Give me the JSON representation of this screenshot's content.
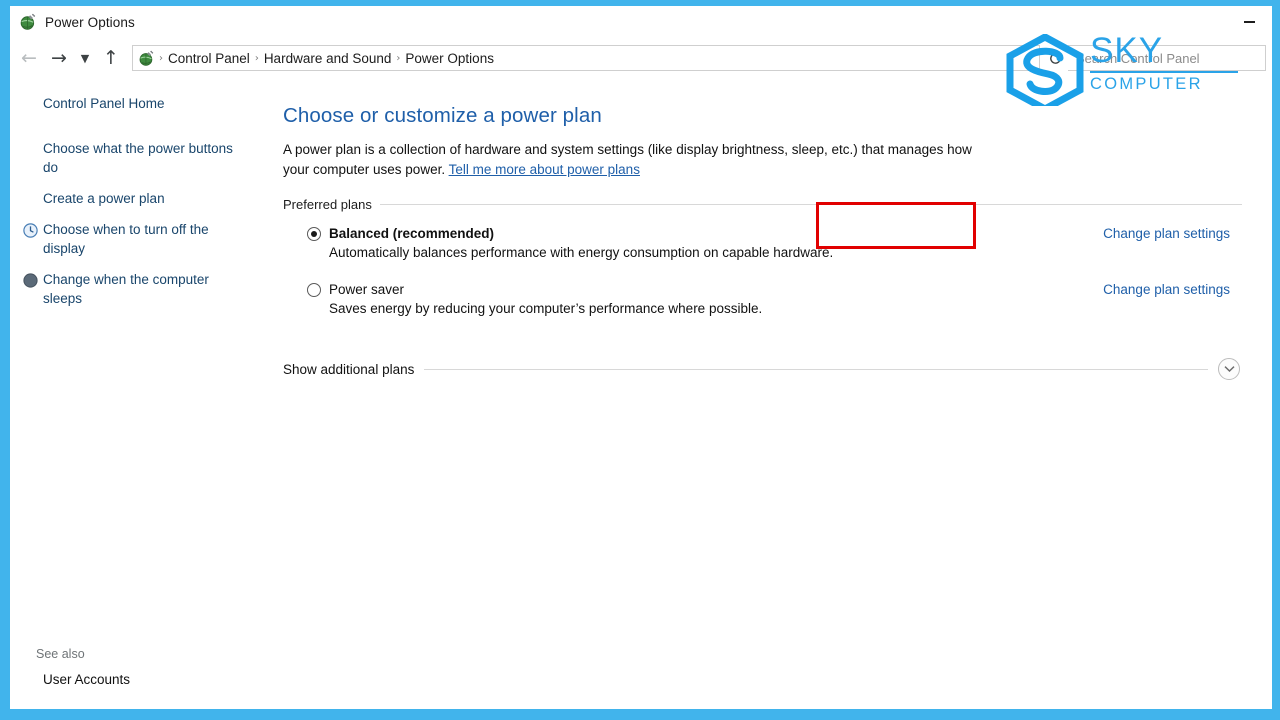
{
  "window": {
    "title": "Power Options",
    "title_icon": "power-plug-globe-icon",
    "minimize_label": "Minimize",
    "border_color": "#41b4ec"
  },
  "nav": {
    "back_icon": "back-arrow-icon",
    "forward_icon": "forward-arrow-icon",
    "history_icon": "chevron-down-icon",
    "up_icon": "up-arrow-icon",
    "refresh_icon": "refresh-icon",
    "breadcrumb_icon": "power-plug-globe-icon",
    "breadcrumbs": [
      "Control Panel",
      "Hardware and Sound",
      "Power Options"
    ],
    "separator": "›"
  },
  "search": {
    "placeholder": "Search Control Panel",
    "value": ""
  },
  "sidebar": {
    "home_label": "Control Panel Home",
    "items": [
      {
        "label": "Choose what the power buttons do",
        "icon": ""
      },
      {
        "label": "Create a power plan",
        "icon": ""
      },
      {
        "label": "Choose when to turn off the display",
        "icon": "clock-icon"
      },
      {
        "label": "Change when the computer sleeps",
        "icon": "moon-sleep-icon"
      }
    ],
    "see_also_label": "See also",
    "see_also_items": [
      {
        "label": "User Accounts"
      }
    ]
  },
  "main": {
    "title": "Choose or customize a power plan",
    "intro_text": "A power plan is a collection of hardware and system settings (like display brightness, sleep, etc.) that manages how your computer uses power. ",
    "intro_link": "Tell me more about power plans",
    "group_legend": "Preferred plans",
    "plans": [
      {
        "name": "Balanced (recommended)",
        "selected": true,
        "bold": true,
        "description": "Automatically balances performance with energy consumption on capable hardware.",
        "link": "Change plan settings",
        "highlighted": true
      },
      {
        "name": "Power saver",
        "selected": false,
        "bold": false,
        "description": "Saves energy by reducing your computer’s performance where possible.",
        "link": "Change plan settings",
        "highlighted": false
      }
    ],
    "additional_plans_label": "Show additional plans",
    "additional_plans_icon": "chevron-down-icon"
  },
  "annotation": {
    "highlight_color": "#e10000",
    "target": "Change plan settings"
  },
  "watermark": {
    "line1": "SKY",
    "line2": "COMPUTER",
    "logo_icon": "sky-s-hexagon-logo",
    "color": "#2aa3e8"
  }
}
